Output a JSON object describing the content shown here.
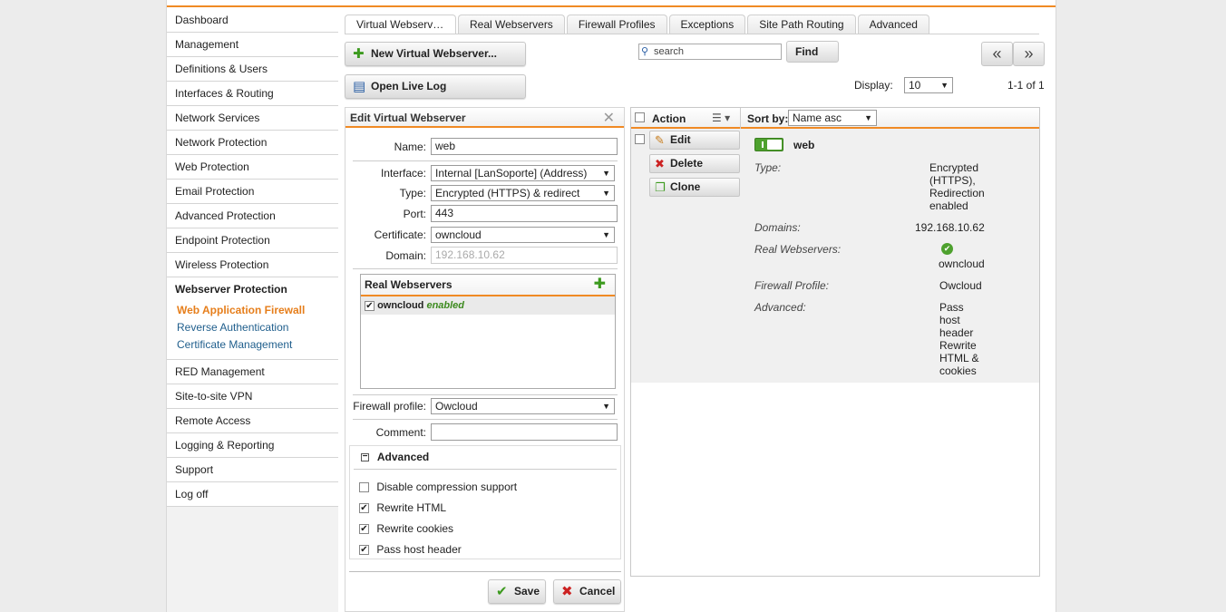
{
  "sidebar": {
    "items_top": [
      "Dashboard",
      "Management",
      "Definitions & Users",
      "Interfaces & Routing",
      "Network Services",
      "Network Protection",
      "Web Protection",
      "Email Protection",
      "Advanced Protection",
      "Endpoint Protection",
      "Wireless Protection"
    ],
    "group_title": "Webserver Protection",
    "group_items": [
      "Web Application Firewall",
      "Reverse Authentication",
      "Certificate Management"
    ],
    "items_bottom": [
      "RED Management",
      "Site-to-site VPN",
      "Remote Access",
      "Logging & Reporting",
      "Support",
      "Log off"
    ]
  },
  "tabs": [
    "Virtual Webserver…",
    "Real Webservers",
    "Firewall Profiles",
    "Exceptions",
    "Site Path Routing",
    "Advanced"
  ],
  "toolbar": {
    "new_label": "New Virtual Webserver...",
    "log_label": "Open Live Log",
    "search_placeholder": "search",
    "find_label": "Find",
    "prev_label": "«",
    "next_label": "»",
    "display_label": "Display:",
    "display_value": "10",
    "count": "1-1 of 1"
  },
  "edit": {
    "title": "Edit Virtual Webserver",
    "name_label": "Name:",
    "name_value": "web",
    "interface_label": "Interface:",
    "interface_value": "Internal [LanSoporte] (Address)",
    "type_label": "Type:",
    "type_value": "Encrypted (HTTPS) & redirect",
    "port_label": "Port:",
    "port_value": "443",
    "cert_label": "Certificate:",
    "cert_value": "owncloud",
    "domain_label": "Domain:",
    "domain_value": "192.168.10.62",
    "rw_title": "Real Webservers",
    "rw_name": "owncloud",
    "rw_status": "enabled",
    "fw_label": "Firewall profile:",
    "fw_value": "Owcloud",
    "comment_label": "Comment:",
    "comment_value": "",
    "adv_title": "Advanced",
    "opt_compress": "Disable compression support",
    "opt_html": "Rewrite HTML",
    "opt_cookies": "Rewrite cookies",
    "opt_host": "Pass host header",
    "save_label": "Save",
    "cancel_label": "Cancel"
  },
  "list": {
    "action_label": "Action",
    "sortby_label": "Sort by:",
    "sort_value": "Name asc",
    "edit_label": "Edit",
    "delete_label": "Delete",
    "clone_label": "Clone",
    "item_name": "web",
    "type_key": "Type:",
    "type_val_1": "Encrypted",
    "type_val_2": "(HTTPS),",
    "type_val_3": "Redirection",
    "type_val_4": "enabled",
    "domains_key": "Domains:",
    "domains_val": "192.168.10.62",
    "rw_key": "Real Webservers:",
    "rw_val": "owncloud",
    "fw_key": "Firewall Profile:",
    "fw_val": "Owcloud",
    "adv_key": "Advanced:",
    "adv_val_1": "Pass",
    "adv_val_2": "host",
    "adv_val_3": "header",
    "adv_val_4": "Rewrite",
    "adv_val_5": "HTML &",
    "adv_val_6": "cookies"
  },
  "colors": {
    "accent": "#f08a24",
    "link": "#1f5e8c",
    "active_link": "#e67e1b",
    "ok": "#4ea12e"
  }
}
